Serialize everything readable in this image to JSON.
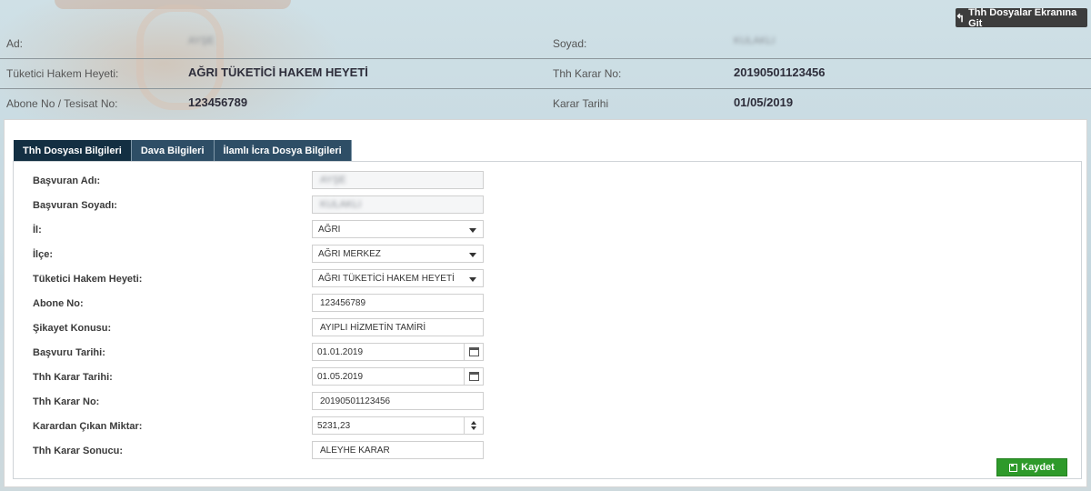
{
  "header": {
    "back_label": "Thh Dosyalar Ekranına Git",
    "back_icon": "reply-arrow-icon"
  },
  "summary": [
    {
      "label1": "Ad:",
      "value1": "AYŞE",
      "label2": "Soyad:",
      "value2": "KULAKLI"
    },
    {
      "label1": "Tüketici Hakem Heyeti:",
      "value1": "AĞRI TÜKETİCİ HAKEM HEYETİ",
      "label2": "Thh Karar No:",
      "value2": "20190501123456"
    },
    {
      "label1": "Abone No / Tesisat No:",
      "value1": "123456789",
      "label2": "Karar Tarihi",
      "value2": "01/05/2019"
    }
  ],
  "tabs": [
    {
      "label": "Thh Dosyası Bilgileri",
      "active": true
    },
    {
      "label": "Dava Bilgileri",
      "active": false
    },
    {
      "label": "İlamlı İcra Dosya Bilgileri",
      "active": false
    }
  ],
  "form": {
    "fields": [
      {
        "label": "Başvuran Adı:",
        "value": "AYŞE"
      },
      {
        "label": "Başvuran Soyadı:",
        "value": "KULAKLI"
      },
      {
        "label": "İl:",
        "value": "AĞRI"
      },
      {
        "label": "İlçe:",
        "value": "AĞRI MERKEZ"
      },
      {
        "label": "Tüketici Hakem Heyeti:",
        "value": "AĞRI TÜKETİCİ HAKEM HEYETİ"
      },
      {
        "label": "Abone No:",
        "value": "123456789"
      },
      {
        "label": "Şikayet Konusu:",
        "value": "AYIPLI HİZMETİN TAMİRİ"
      },
      {
        "label": "Başvuru Tarihi:",
        "value": "01.01.2019"
      },
      {
        "label": "Thh Karar Tarihi:",
        "value": "01.05.2019"
      },
      {
        "label": "Thh Karar No:",
        "value": "20190501123456"
      },
      {
        "label": "Karardan Çıkan Miktar:",
        "value": "5231,23"
      },
      {
        "label": "Thh Karar Sonucu:",
        "value": "ALEYHE KARAR"
      }
    ],
    "save_label": "Kaydet",
    "save_icon": "floppy-disk-icon"
  },
  "colors": {
    "tab_active": "#132f42",
    "tab_inactive": "#2e4e66",
    "save_button": "#2e9a2a",
    "back_button": "#3d3d3d"
  }
}
